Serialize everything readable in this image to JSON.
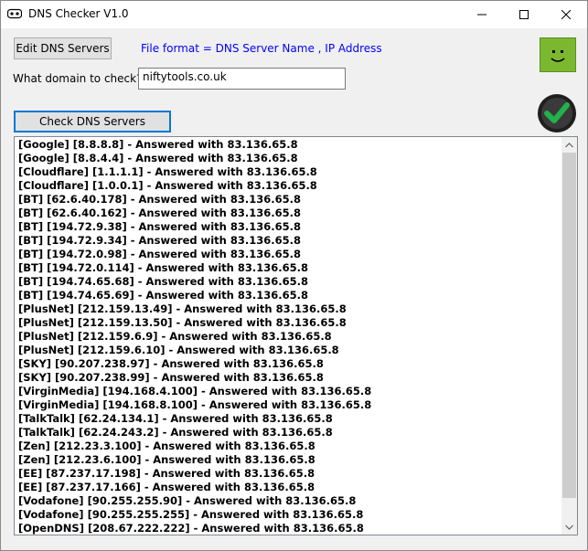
{
  "window": {
    "title": "DNS Checker V1.0"
  },
  "toolbar": {
    "edit_label": "Edit DNS Servers",
    "format_text": "File format = DNS Server Name , IP Address"
  },
  "domain": {
    "label": "What domain to check?",
    "value": "niftytools.co.uk"
  },
  "actions": {
    "check_label": "Check DNS Servers"
  },
  "status": {
    "smiley_color": "#7cb82f",
    "check_color": "#22b14c"
  },
  "results": [
    "[Google] [8.8.8.8] - Answered with 83.136.65.8",
    "[Google] [8.8.4.4] - Answered with 83.136.65.8",
    "[Cloudflare] [1.1.1.1] - Answered with 83.136.65.8",
    "[Cloudflare] [1.0.0.1] - Answered with 83.136.65.8",
    "[BT] [62.6.40.178] - Answered with 83.136.65.8",
    "[BT] [62.6.40.162] - Answered with 83.136.65.8",
    "[BT] [194.72.9.38] - Answered with 83.136.65.8",
    "[BT] [194.72.9.34] - Answered with 83.136.65.8",
    "[BT] [194.72.0.98] - Answered with 83.136.65.8",
    "[BT] [194.72.0.114] - Answered with 83.136.65.8",
    "[BT] [194.74.65.68] - Answered with 83.136.65.8",
    "[BT] [194.74.65.69] - Answered with 83.136.65.8",
    "[PlusNet] [212.159.13.49] - Answered with 83.136.65.8",
    "[PlusNet] [212.159.13.50] - Answered with 83.136.65.8",
    "[PlusNet] [212.159.6.9] - Answered with 83.136.65.8",
    "[PlusNet] [212.159.6.10] - Answered with 83.136.65.8",
    "[SKY] [90.207.238.97] - Answered with 83.136.65.8",
    "[SKY] [90.207.238.99] - Answered with 83.136.65.8",
    "[VirginMedia] [194.168.4.100] - Answered with 83.136.65.8",
    "[VirginMedia] [194.168.8.100] - Answered with 83.136.65.8",
    "[TalkTalk] [62.24.134.1] - Answered with 83.136.65.8",
    "[TalkTalk] [62.24.243.2] - Answered with 83.136.65.8",
    "[Zen] [212.23.3.100] - Answered with 83.136.65.8",
    "[Zen] [212.23.6.100] - Answered with 83.136.65.8",
    "[EE] [87.237.17.198] - Answered with 83.136.65.8",
    "[EE] [87.237.17.166] - Answered with 83.136.65.8",
    "[Vodafone] [90.255.255.90] - Answered with 83.136.65.8",
    "[Vodafone] [90.255.255.255] - Answered with 83.136.65.8",
    "[OpenDNS] [208.67.222.222] - Answered with 83.136.65.8"
  ]
}
